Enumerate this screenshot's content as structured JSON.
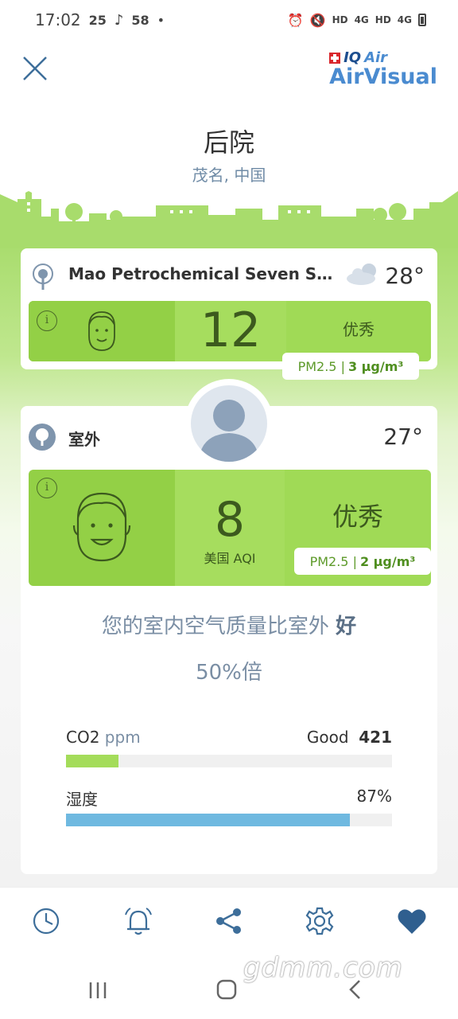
{
  "status_bar": {
    "time": "17:02",
    "icon1": "25",
    "icon3": "58",
    "dot": "•",
    "hd1": "HD",
    "sig1": "4G",
    "hd2": "HD",
    "sig2": "4G"
  },
  "header": {
    "logo_brand_iq": "IQ",
    "logo_brand_air": "Air",
    "logo_product": "AirVisual"
  },
  "location": {
    "name": "后院",
    "city": "茂名, 中国"
  },
  "station": {
    "name": "Mao Petrochemical Seven Small...",
    "temperature": "28°",
    "aqi": "12",
    "status": "优秀",
    "pm_label": "PM2.5 |",
    "pm_value": "3 µg/m³",
    "weather_icon": "cloud-icon"
  },
  "outdoor": {
    "label": "室外",
    "temperature": "27°",
    "aqi": "8",
    "aqi_unit": "美国 AQI",
    "status": "优秀",
    "pm_label": "PM2.5 |",
    "pm_value": "2 µg/m³"
  },
  "comparison": {
    "text": "您的室内空气质量比室外",
    "emphasis": "好",
    "ratio": "50%倍"
  },
  "metrics": {
    "co2": {
      "label": "CO2",
      "unit": "ppm",
      "status": "Good",
      "value": "421",
      "fraction": 0.16,
      "color": "#a4dc5a"
    },
    "humidity": {
      "label": "湿度",
      "value": "87%",
      "fraction": 0.87,
      "color": "#6fb9e0"
    }
  },
  "tabs": [
    "history-icon",
    "alarm-bell-icon",
    "share-icon",
    "settings-gear-icon",
    "favorite-heart-icon"
  ],
  "colors": {
    "accent_green": "#a6dd5e",
    "brand_blue": "#4a8bd0",
    "icon_blue": "#3d6e9a"
  },
  "watermark": "gdmm.com"
}
